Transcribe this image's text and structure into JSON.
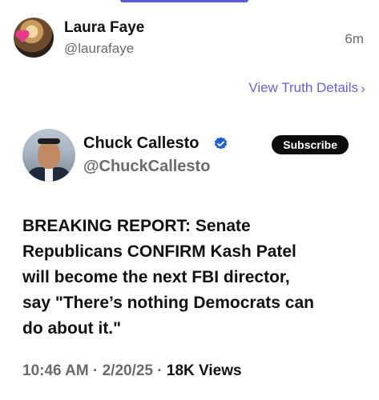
{
  "post": {
    "author_name": "Laura Faye",
    "author_handle": "@laurafaye",
    "time_ago": "6m",
    "view_details_label": "View Truth Details",
    "chevron_glyph": "›"
  },
  "quoted": {
    "author_name": "Chuck Callesto",
    "author_handle": "@ChuckCallesto",
    "verified": true,
    "subscribe_label": "Subscribe",
    "body": "BREAKING REPORT: Senate\nRepublicans CONFIRM Kash Patel\nwill become the next FBI director,\nsay  \"There’s nothing Democrats can\ndo about it.\"",
    "time": "10:46 AM",
    "date": "2/20/25",
    "views_count": "18K",
    "views_label": "Views",
    "separator": " · "
  },
  "colors": {
    "accent": "#6a5fd8",
    "verified": "#1d5fd1",
    "muted_text": "#6b6b6b",
    "button_bg": "#0c0c0c"
  },
  "icons": {
    "verified": "verified-badge-icon",
    "chevron": "chevron-right-icon"
  }
}
